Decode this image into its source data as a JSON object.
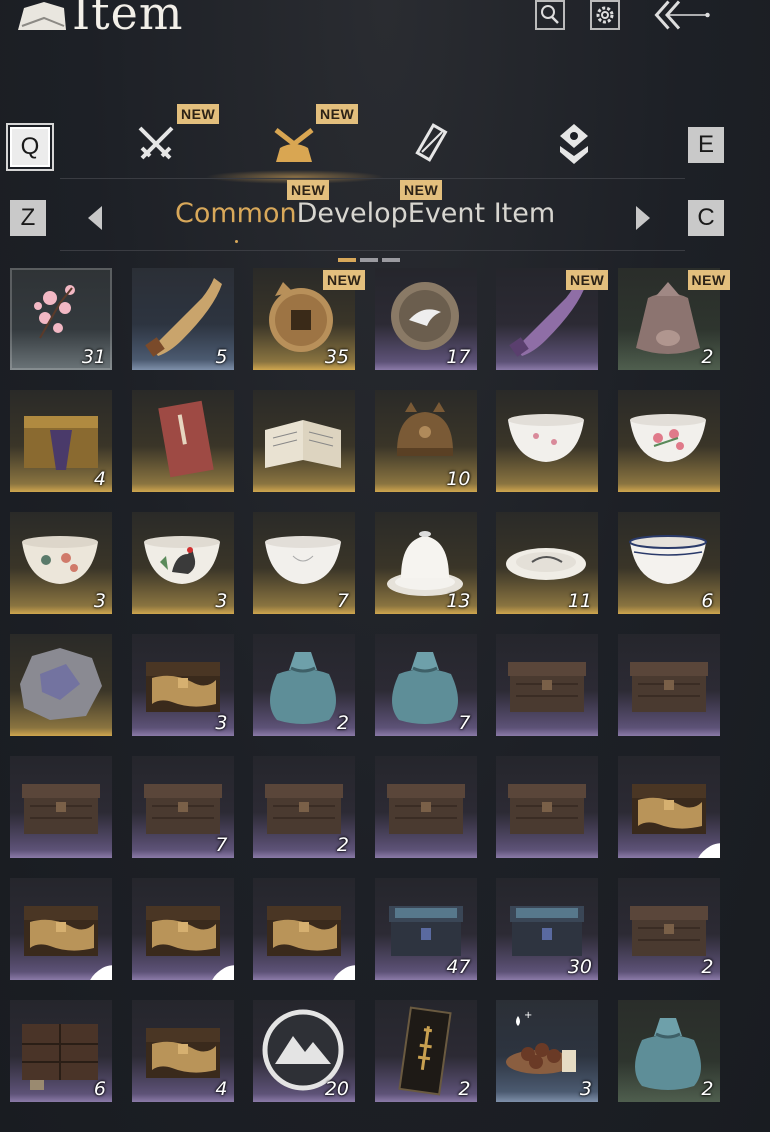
{
  "header": {
    "title": "Item"
  },
  "keys": {
    "prev_category": "Q",
    "next_category": "E",
    "prev_tab": "Z",
    "next_tab": "C"
  },
  "category_badges": [
    "NEW",
    "NEW"
  ],
  "tab_badges": [
    "NEW",
    "NEW"
  ],
  "tabs": [
    {
      "label": "Common",
      "active": true
    },
    {
      "label": "Develop",
      "active": false
    },
    {
      "label": "Event Item",
      "active": false
    }
  ],
  "categories": [
    {
      "icon": "crossed-swords-icon",
      "new": true
    },
    {
      "icon": "bundle-icon",
      "new": true,
      "active": true
    },
    {
      "icon": "scroll-icon",
      "new": false
    },
    {
      "icon": "token-icon",
      "new": false
    }
  ],
  "items": [
    {
      "name": "plum-blossom",
      "bg": "pinkbg",
      "count": "31"
    },
    {
      "name": "horn",
      "bg": "blue",
      "count": "5"
    },
    {
      "name": "coin-pouch",
      "bg": "gold",
      "count": "35",
      "new": "NEW"
    },
    {
      "name": "crane-medallion",
      "bg": "purple",
      "count": "17"
    },
    {
      "name": "purple-horn",
      "bg": "purple",
      "count": "",
      "new": "NEW"
    },
    {
      "name": "cloth-pouch",
      "bg": "green",
      "count": "2",
      "new": "NEW"
    },
    {
      "name": "ornate-chest",
      "bg": "gold",
      "count": "4"
    },
    {
      "name": "red-book",
      "bg": "gold",
      "count": ""
    },
    {
      "name": "open-book",
      "bg": "gold",
      "count": ""
    },
    {
      "name": "bronze-helmet",
      "bg": "gold",
      "count": "10"
    },
    {
      "name": "plum-bowl",
      "bg": "gold",
      "count": ""
    },
    {
      "name": "floral-bowl",
      "bg": "gold",
      "count": ""
    },
    {
      "name": "painted-bowl",
      "bg": "gold",
      "count": "3"
    },
    {
      "name": "rooster-bowl",
      "bg": "gold",
      "count": "3"
    },
    {
      "name": "white-bowl",
      "bg": "gold",
      "count": "7"
    },
    {
      "name": "lidded-cup",
      "bg": "gold",
      "count": "13"
    },
    {
      "name": "painted-plate",
      "bg": "gold",
      "count": "11"
    },
    {
      "name": "blue-rim-bowl",
      "bg": "gold",
      "count": "6"
    },
    {
      "name": "ore-stone",
      "bg": "gold",
      "count": ""
    },
    {
      "name": "gold-chest",
      "bg": "purple",
      "count": "3"
    },
    {
      "name": "blue-sack",
      "bg": "purple",
      "count": "2"
    },
    {
      "name": "blue-sack",
      "bg": "purple",
      "count": "7"
    },
    {
      "name": "dark-chest",
      "bg": "purple",
      "count": ""
    },
    {
      "name": "dark-chest",
      "bg": "purple",
      "count": ""
    },
    {
      "name": "dark-chest",
      "bg": "purple",
      "count": ""
    },
    {
      "name": "dark-chest",
      "bg": "purple",
      "count": "7"
    },
    {
      "name": "dark-chest",
      "bg": "purple",
      "count": "2"
    },
    {
      "name": "dark-chest",
      "bg": "purple",
      "count": ""
    },
    {
      "name": "dark-chest",
      "bg": "purple",
      "count": ""
    },
    {
      "name": "gold-chest",
      "bg": "purple",
      "count": "",
      "heart": true
    },
    {
      "name": "gold-chest",
      "bg": "purple",
      "count": "",
      "heart": true
    },
    {
      "name": "gold-chest",
      "bg": "purple",
      "count": "",
      "heart": true
    },
    {
      "name": "gold-chest",
      "bg": "purple",
      "count": "",
      "heart": true
    },
    {
      "name": "rainbow-chest",
      "bg": "purple",
      "count": "47"
    },
    {
      "name": "rainbow-chest",
      "bg": "purple",
      "count": "30"
    },
    {
      "name": "dark-chest",
      "bg": "purple",
      "count": "2"
    },
    {
      "name": "cabinet",
      "bg": "purple",
      "count": "6"
    },
    {
      "name": "gold-chest",
      "bg": "purple",
      "count": "4"
    },
    {
      "name": "mountain-token",
      "bg": "purple",
      "count": "20"
    },
    {
      "name": "talisman-card",
      "bg": "purple",
      "count": "2"
    },
    {
      "name": "pill-plate",
      "bg": "blue",
      "count": "3"
    },
    {
      "name": "blue-sack",
      "bg": "green",
      "count": "2"
    }
  ],
  "colors": {
    "accent": "#d8a85a",
    "badge": "#e3bf7d"
  }
}
